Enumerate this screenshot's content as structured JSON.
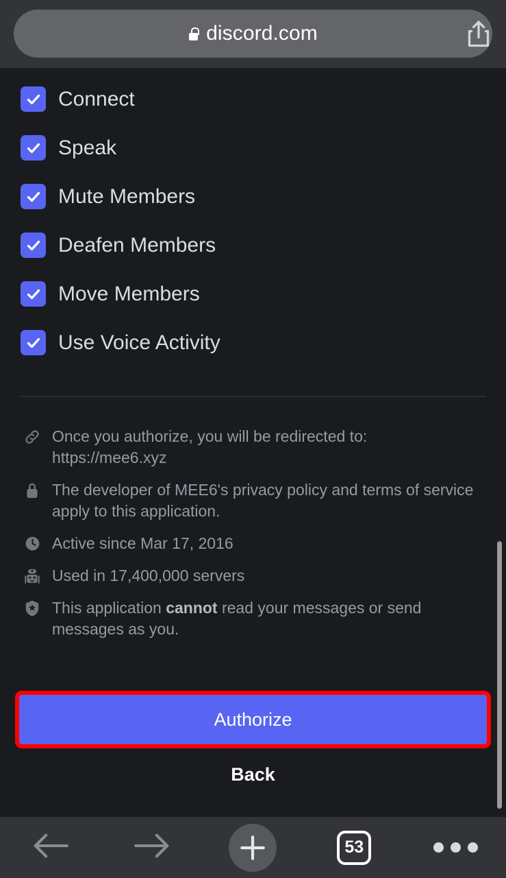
{
  "browser": {
    "address_bar": {
      "url": "discord.com",
      "lock_icon": "lock-icon",
      "share_icon": "share-icon",
      "pill_color": "#636569",
      "bar_color": "#333438"
    },
    "toolbar": {
      "back_icon": "arrow-left-icon",
      "forward_icon": "arrow-right-icon",
      "new_tab_icon": "plus-icon",
      "tab_count": "53",
      "more_icon": "ellipsis-icon"
    }
  },
  "page": {
    "background_color": "#1a1b1e",
    "accent_color": "#5865f2",
    "highlight_color": "#ff0000",
    "text_color": "#dbdee1",
    "muted_text_color": "#949ba4",
    "permissions": [
      {
        "label": "Connect",
        "checked": true
      },
      {
        "label": "Speak",
        "checked": true
      },
      {
        "label": "Mute Members",
        "checked": true
      },
      {
        "label": "Deafen Members",
        "checked": true
      },
      {
        "label": "Move Members",
        "checked": true
      },
      {
        "label": "Use Voice Activity",
        "checked": true
      }
    ],
    "info": [
      {
        "icon": "link-icon",
        "text": "Once you authorize, you will be redirected to: https://mee6.xyz"
      },
      {
        "icon": "lock-icon",
        "text": "The developer of MEE6's privacy policy and terms of service apply to this application."
      },
      {
        "icon": "clock-icon",
        "text": "Active since Mar 17, 2016"
      },
      {
        "icon": "robot-icon",
        "text": "Used in 17,400,000 servers"
      },
      {
        "icon": "shield-star-icon",
        "text_before": "This application ",
        "text_bold": "cannot",
        "text_after": " read your messages or send messages as you."
      }
    ],
    "actions": {
      "authorize_label": "Authorize",
      "back_label": "Back"
    }
  }
}
